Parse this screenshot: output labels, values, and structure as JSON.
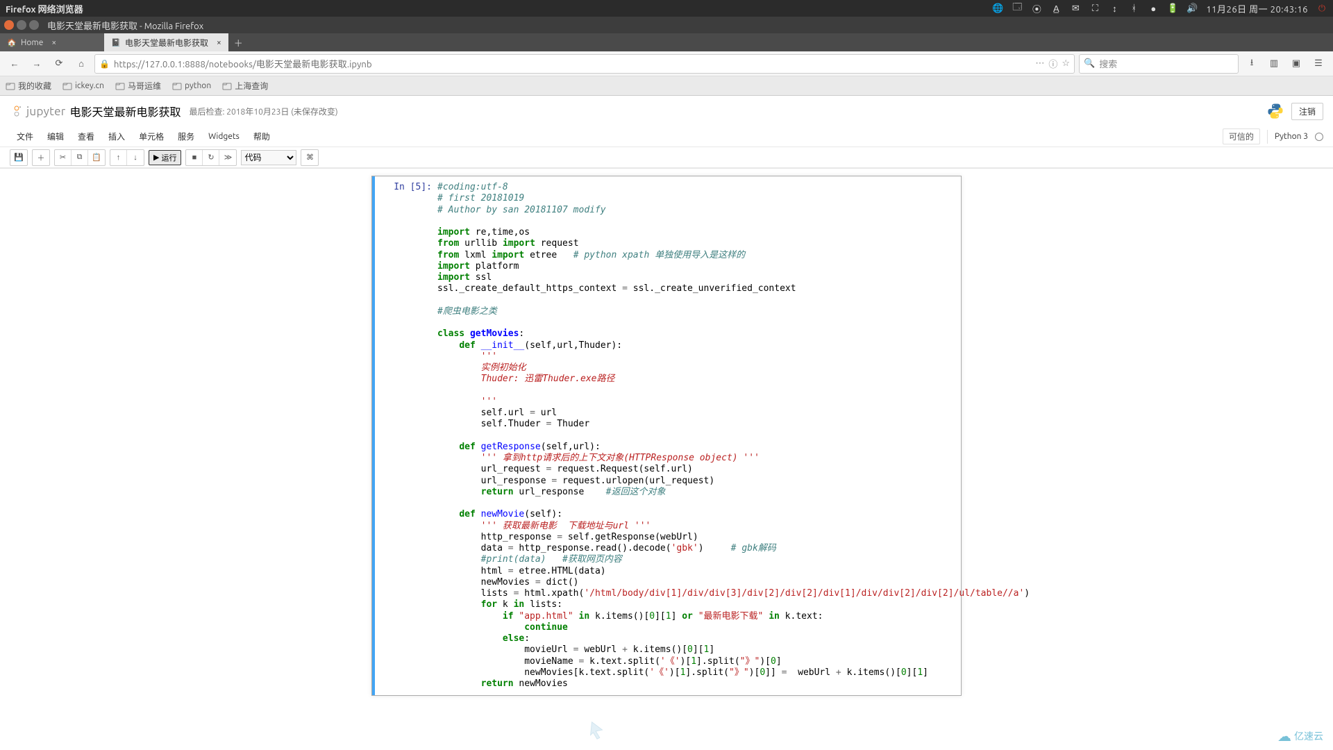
{
  "os_topbar": {
    "app": "Firefox 网络浏览器",
    "clock": "11月26日 周一 20:43:16"
  },
  "firefox": {
    "window_title": "电影天堂最新电影获取 - Mozilla Firefox",
    "tabs": [
      {
        "title": "Home",
        "active": false
      },
      {
        "title": "电影天堂最新电影获取",
        "active": true
      }
    ],
    "url": "https://127.0.0.1:8888/notebooks/电影天堂最新电影获取.ipynb",
    "search_placeholder": "搜索",
    "bookmarks": [
      "我的收藏",
      "ickey.cn",
      "马哥运维",
      "python",
      "上海查询"
    ]
  },
  "jupyter": {
    "logo_text": "jupyter",
    "notebook_name": "电影天堂最新电影获取",
    "checkpoint": "最后检查: 2018年10月23日  (未保存改变)",
    "logout": "注销",
    "menus": [
      "文件",
      "编辑",
      "查看",
      "插入",
      "单元格",
      "服务",
      "Widgets",
      "帮助"
    ],
    "trusted": "可信的",
    "kernel": "Python 3",
    "run_label": "运行",
    "cell_type": "代码",
    "prompt": "In [5]:"
  },
  "watermark": "亿速云"
}
